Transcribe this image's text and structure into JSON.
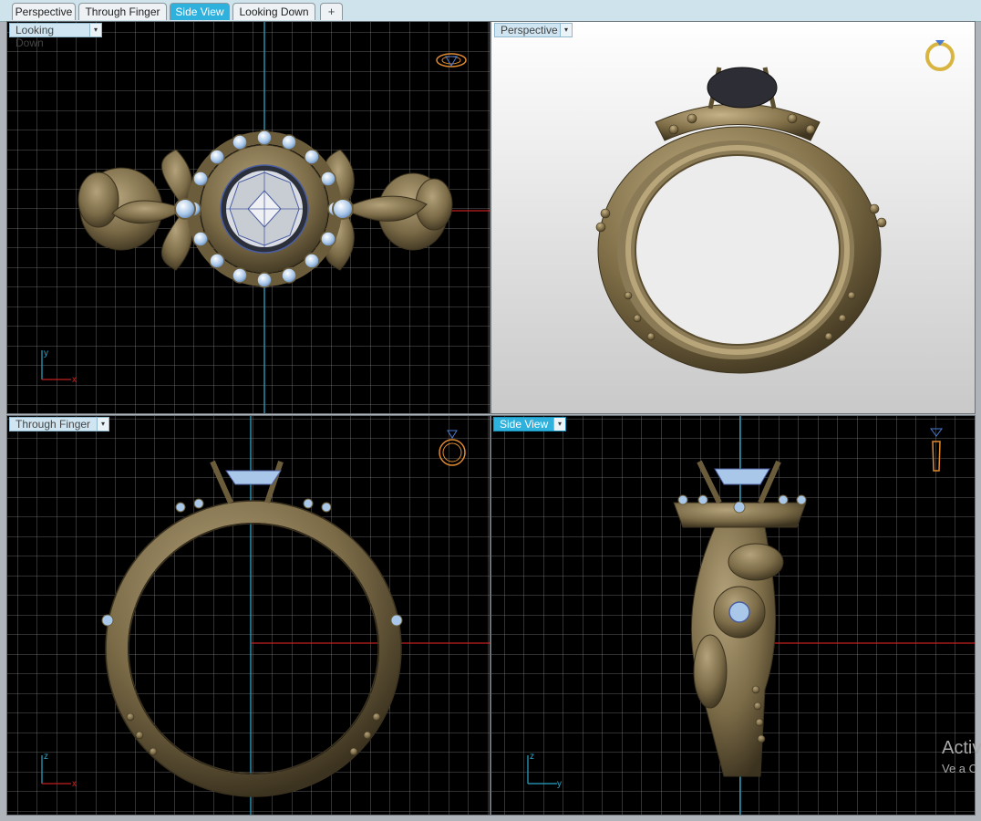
{
  "tabs": [
    {
      "label": "Perspective",
      "active": false
    },
    {
      "label": "Through Finger",
      "active": false
    },
    {
      "label": "Side View",
      "active": true
    },
    {
      "label": "Looking Down",
      "active": false
    }
  ],
  "add_tab_symbol": "+",
  "viewports": {
    "top_left": {
      "title": "Looking Down",
      "axis_v": "y",
      "axis_h": "x"
    },
    "top_right": {
      "title": "Perspective"
    },
    "bottom_left": {
      "title": "Through Finger",
      "axis_v": "z",
      "axis_h": "x"
    },
    "bottom_right": {
      "title": "Side View",
      "axis_v": "z",
      "axis_h": "y"
    }
  },
  "dropdown_symbol": "▾",
  "watermark": {
    "line1": "Activ",
    "line2": "Ve a C"
  },
  "colors": {
    "grid_bg": "#000000",
    "grid_line": "#7d7d7d",
    "axis_blue": "#2aa6c8",
    "axis_red": "#c42020",
    "gold": "#7a6c48",
    "diamond": "#a9c7e8",
    "tab_active": "#2fb1dd"
  },
  "icons": [
    "ring-orientation-icon",
    "dropdown-arrow-icon",
    "axis-gizmo-icon",
    "add-tab-icon"
  ]
}
